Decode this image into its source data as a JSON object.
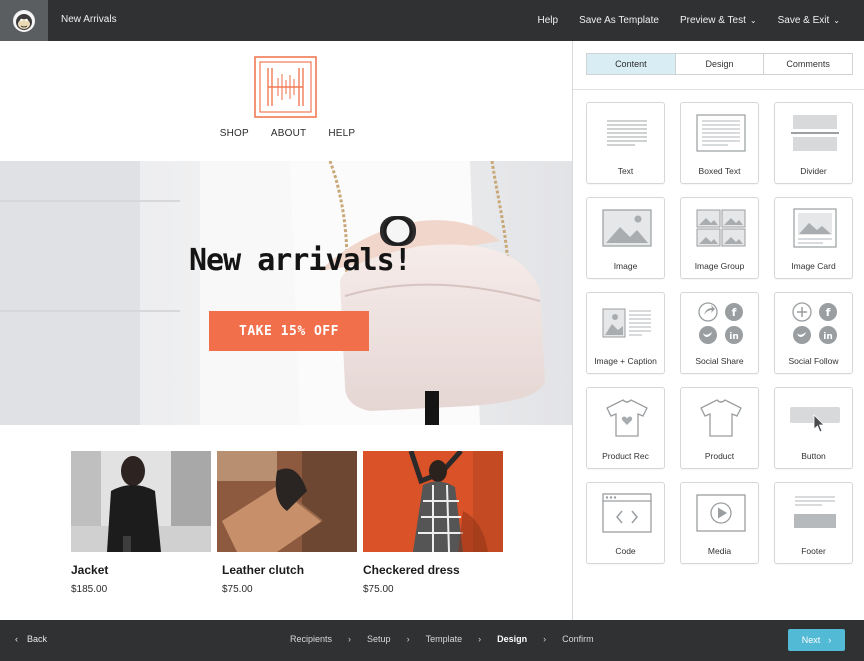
{
  "topbar": {
    "title": "New Arrivals",
    "nav": [
      {
        "label": "Help",
        "has_caret": false
      },
      {
        "label": "Save As Template",
        "has_caret": false
      },
      {
        "label": "Preview & Test",
        "has_caret": true
      },
      {
        "label": "Save & Exit",
        "has_caret": true
      }
    ]
  },
  "email": {
    "nav": [
      "SHOP",
      "ABOUT",
      "HELP"
    ],
    "hero": {
      "headline": "New arrivals!",
      "cta": "TAKE 15% OFF",
      "accent_color": "#f26f4c"
    },
    "products": [
      {
        "name": "Jacket",
        "price": "$185.00"
      },
      {
        "name": "Leather clutch",
        "price": "$75.00"
      },
      {
        "name": "Checkered dress",
        "price": "$75.00"
      }
    ]
  },
  "panel": {
    "tabs": [
      "Content",
      "Design",
      "Comments"
    ],
    "active_tab": "Content",
    "blocks": [
      {
        "label": "Text",
        "icon": "text-icon"
      },
      {
        "label": "Boxed Text",
        "icon": "boxed-text-icon"
      },
      {
        "label": "Divider",
        "icon": "divider-icon"
      },
      {
        "label": "Image",
        "icon": "image-icon"
      },
      {
        "label": "Image Group",
        "icon": "image-group-icon"
      },
      {
        "label": "Image Card",
        "icon": "image-card-icon"
      },
      {
        "label": "Image + Caption",
        "icon": "image-caption-icon"
      },
      {
        "label": "Social Share",
        "icon": "social-share-icon"
      },
      {
        "label": "Social Follow",
        "icon": "social-follow-icon"
      },
      {
        "label": "Product Rec",
        "icon": "product-rec-icon"
      },
      {
        "label": "Product",
        "icon": "product-icon"
      },
      {
        "label": "Button",
        "icon": "button-icon"
      },
      {
        "label": "Code",
        "icon": "code-icon"
      },
      {
        "label": "Media",
        "icon": "media-icon"
      },
      {
        "label": "Footer",
        "icon": "footer-icon"
      }
    ]
  },
  "footer": {
    "back_label": "Back",
    "steps": [
      "Recipients",
      "Setup",
      "Template",
      "Design",
      "Confirm"
    ],
    "current_step": "Design",
    "next_label": "Next",
    "next_color": "#52bad5"
  }
}
